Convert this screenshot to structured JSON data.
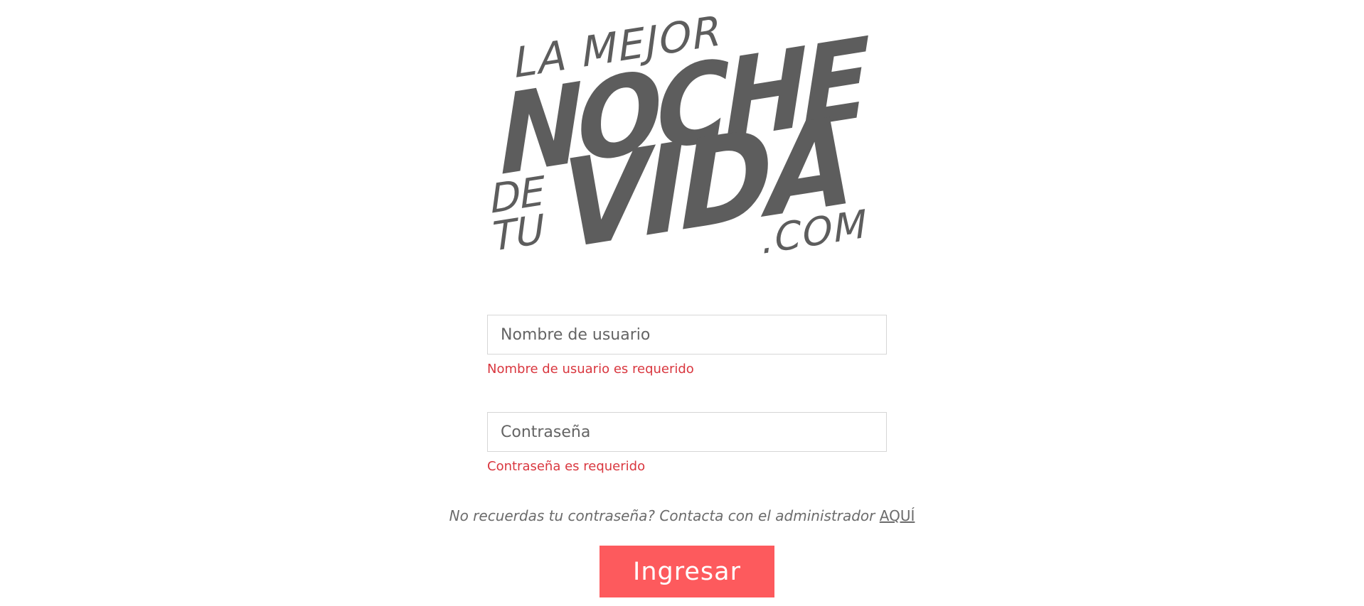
{
  "logo": {
    "line1": "LA MEJOR",
    "line2": "NOCHE",
    "line3a": "DE",
    "line3b": "TU",
    "line4": "VIDA",
    "line5": ".COM",
    "color": "#5d5d5d"
  },
  "form": {
    "username": {
      "placeholder": "Nombre de usuario",
      "value": "",
      "error": "Nombre de usuario es requerido"
    },
    "password": {
      "placeholder": "Contraseña",
      "value": "",
      "error": "Contraseña es requerido"
    },
    "forgot_text": "No recuerdas tu contraseña? Contacta con el administrador",
    "forgot_link": "AQUÍ",
    "submit_label": "Ingresar"
  },
  "colors": {
    "accent": "#fd5a5d",
    "error": "#d9373f",
    "border": "#d6d6d6"
  }
}
